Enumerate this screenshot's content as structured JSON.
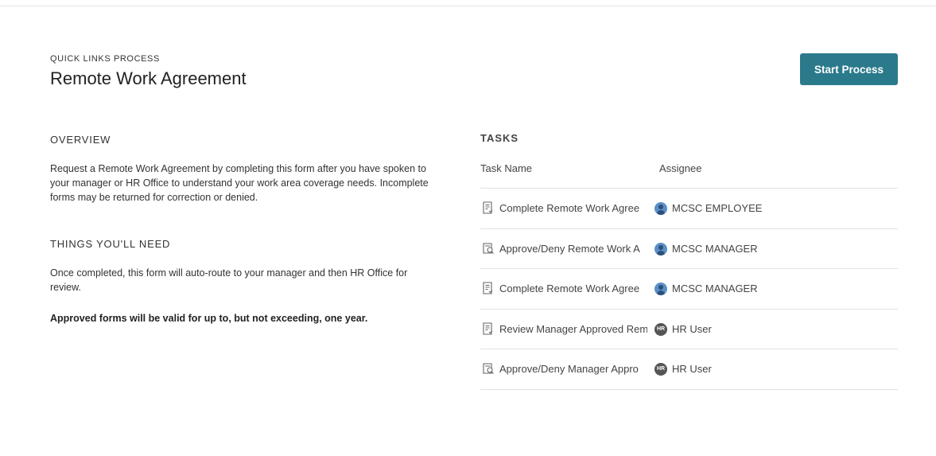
{
  "header": {
    "eyebrow": "QUICK LINKS PROCESS",
    "title": "Remote Work Agreement",
    "start_button": "Start Process"
  },
  "overview": {
    "heading": "OVERVIEW",
    "line1": "Request a Remote Work Agreement by completing this form after you have spoken to",
    "line2": "your manager or HR Office to understand your work area coverage needs.  Incomplete",
    "line3": "forms may be returned for correction or denied."
  },
  "needs": {
    "heading": "THINGS YOU'LL NEED",
    "line1": "Once completed, this form will auto-route to your manager and then HR Office for",
    "line2": "review.",
    "bold_note": "Approved forms will be valid for up to, but not exceeding, one year."
  },
  "tasks": {
    "heading": "TASKS",
    "col_task": "Task Name",
    "col_assignee": "Assignee",
    "rows": [
      {
        "name": "Complete Remote Work Agree",
        "icon": "form-icon",
        "avatar": "person-avatar",
        "assignee": "MCSC EMPLOYEE"
      },
      {
        "name": "Approve/Deny Remote Work A",
        "icon": "approval-form-icon",
        "avatar": "person-avatar",
        "assignee": "MCSC MANAGER"
      },
      {
        "name": "Complete Remote Work Agree",
        "icon": "form-icon",
        "avatar": "person-avatar",
        "assignee": "MCSC MANAGER"
      },
      {
        "name": "Review Manager Approved Rem",
        "icon": "form-icon",
        "avatar": "hr-avatar",
        "assignee": "HR User"
      },
      {
        "name": "Approve/Deny Manager Appro",
        "icon": "approval-form-icon",
        "avatar": "hr-avatar",
        "assignee": "HR User"
      }
    ],
    "hr_badge_text": "HR"
  },
  "colors": {
    "accent": "#2b7a8c",
    "avatar_person": "#5a8fc7",
    "avatar_hr": "#555555"
  }
}
